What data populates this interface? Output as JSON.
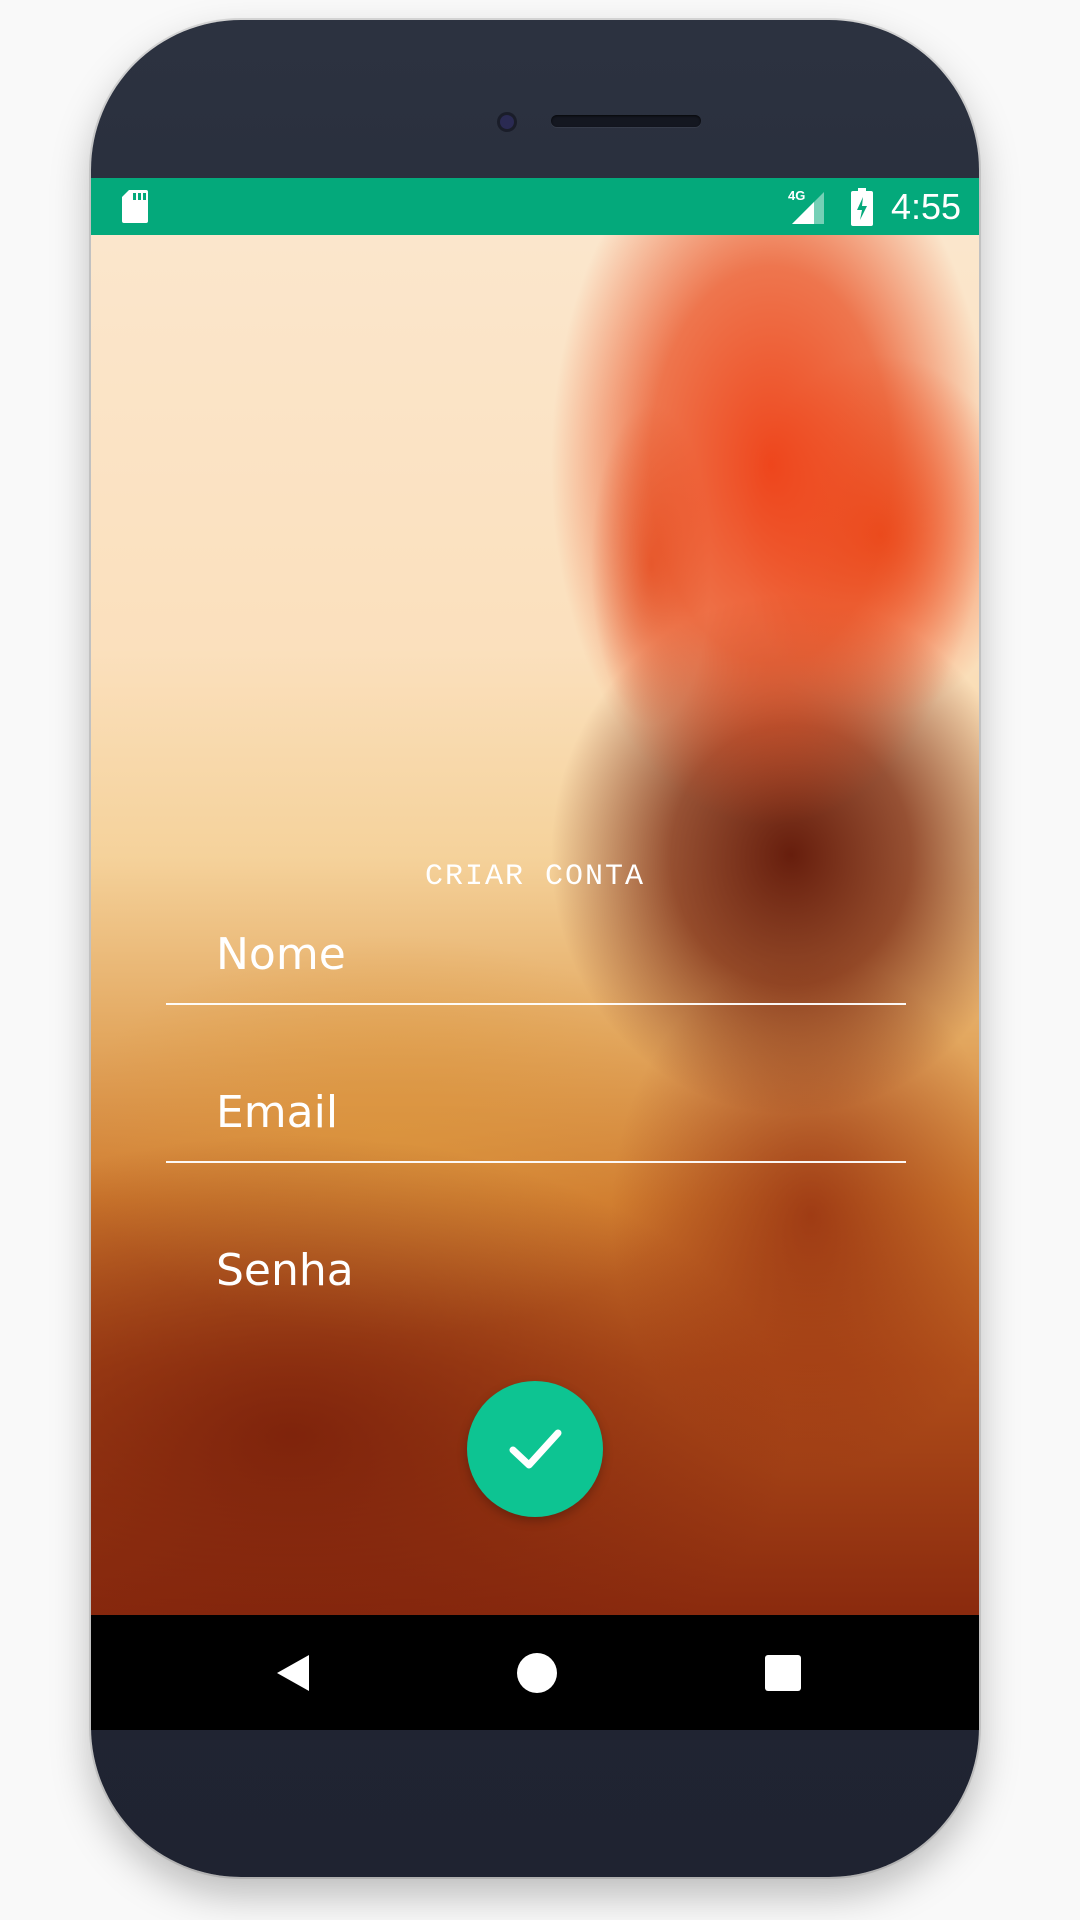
{
  "status_bar": {
    "time": "4:55",
    "network": "4G",
    "icons": [
      "sd-card-icon",
      "signal-icon",
      "battery-charging-icon"
    ],
    "color": "#04a97b"
  },
  "form": {
    "title": "CRIAR CONTA",
    "fields": [
      {
        "placeholder": "Nome"
      },
      {
        "placeholder": "Email"
      },
      {
        "placeholder": "Senha"
      }
    ],
    "submit_icon": "check-icon",
    "submit_color": "#0dc492"
  },
  "nav_bar": {
    "icons": [
      "back-triangle-icon",
      "home-circle-icon",
      "recents-square-icon"
    ]
  }
}
